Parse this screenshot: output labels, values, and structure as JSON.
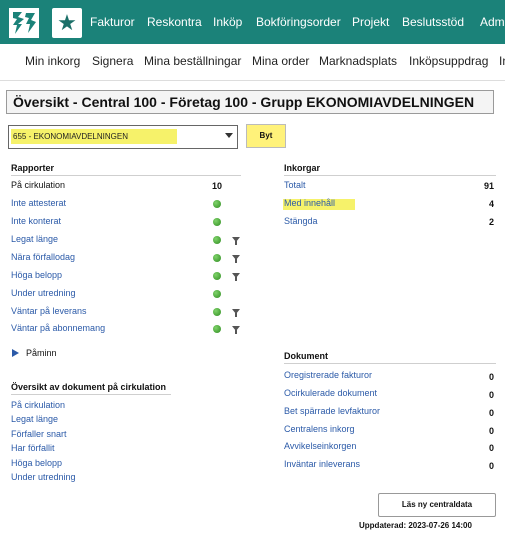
{
  "topnav": {
    "logo": "logo-icon",
    "star": "★",
    "items": [
      "Fakturor",
      "Reskontra",
      "Inköp",
      "Bokföringsorder",
      "Projekt",
      "Beslutsstöd",
      "Adm"
    ]
  },
  "subnav": {
    "items": [
      "Min inkorg",
      "Signera",
      "Mina beställningar",
      "Mina order",
      "Marknadsplats",
      "Inköpsuppdrag",
      "In"
    ]
  },
  "title": "Översikt - Central 100 - Företag 100 - Grupp EKONOMIAVDELNINGEN",
  "selector": {
    "value": "655 - EKONOMIAVDELNINGEN",
    "button": "Byt"
  },
  "rapporter": {
    "heading": "Rapporter",
    "first": {
      "label": "På cirkulation",
      "value": "10"
    },
    "items": [
      "Inte attesterat",
      "Inte konterat",
      "Legat länge",
      "Nära förfallodag",
      "Höga belopp",
      "Under utredning",
      "Väntar på leverans",
      "Väntar på abonnemang"
    ]
  },
  "paminn": "Påminn",
  "oversikt": {
    "heading": "Översikt av dokument på cirkulation",
    "items": [
      "På cirkulation",
      "Legat länge",
      "Förfaller snart",
      "Har förfallit",
      "Höga belopp",
      "Under utredning"
    ]
  },
  "inkorgar": {
    "heading": "Inkorgar",
    "items": [
      {
        "label": "Totalt",
        "value": "91"
      },
      {
        "label": "Med innehåll",
        "value": "4"
      },
      {
        "label": "Stängda",
        "value": "2"
      }
    ]
  },
  "dokument": {
    "heading": "Dokument",
    "items": [
      {
        "label": "Oregistrerade fakturor",
        "value": "0"
      },
      {
        "label": "Ocirkulerade dokument",
        "value": "0"
      },
      {
        "label": "Bet spärrade levfakturor",
        "value": "0"
      },
      {
        "label": "Centralens inkorg",
        "value": "0"
      },
      {
        "label": "Avvikelseinkorgen",
        "value": "0"
      },
      {
        "label": "Inväntar inleverans",
        "value": "0"
      }
    ]
  },
  "refresh_button": "Läs ny centraldata",
  "updated": "Uppdaterad: 2023-07-26 14:00",
  "colors": {
    "nav": "#1b8279",
    "highlight": "#f6f26a",
    "link": "#2b5aa8",
    "status_dot": "#3a9a2a"
  }
}
